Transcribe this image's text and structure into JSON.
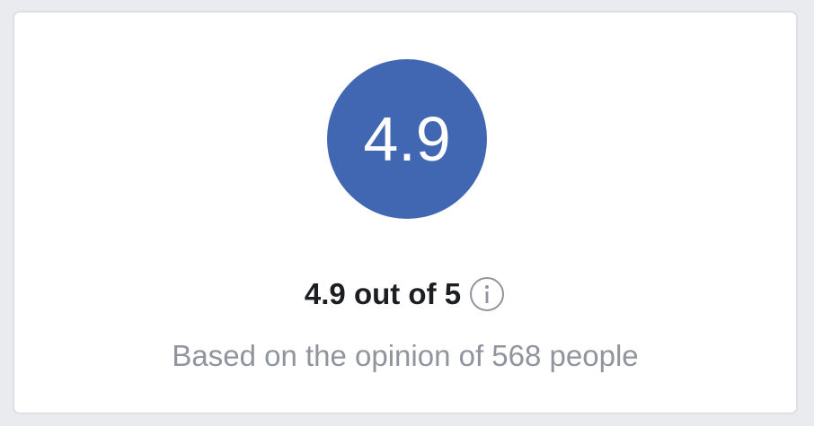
{
  "rating": {
    "value": "4.9",
    "summary": "4.9 out of 5",
    "basis": "Based on the opinion of 568 people"
  },
  "icons": {
    "info": "info-circle-icon"
  },
  "colors": {
    "accent": "#4267b2",
    "title_text": "#1c1e21",
    "muted_text": "#90949c"
  }
}
